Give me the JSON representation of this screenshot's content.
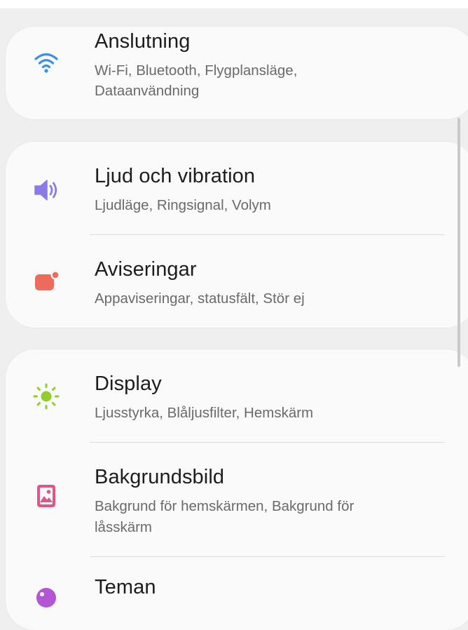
{
  "settings": {
    "connection": {
      "title": "Anslutning",
      "subtitle_line1": "Wi-Fi, Bluetooth, Flygplansläge,",
      "subtitle_line2": "Dataanvändning",
      "icon": "wifi-icon",
      "icon_color": "#3d8ee8"
    },
    "sound": {
      "title": "Ljud och vibration",
      "subtitle_line1": "Ljudläge, Ringsignal, Volym",
      "icon": "volume-icon",
      "icon_color": "#8b7be8"
    },
    "notifications": {
      "title": "Aviseringar",
      "subtitle_line1": "Appaviseringar, statusfält, Stör ej",
      "icon": "notification-icon",
      "icon_color": "#ee6a5a"
    },
    "display": {
      "title": "Display",
      "subtitle_line1": "Ljusstyrka, Blåljusfilter, Hemskärm",
      "icon": "brightness-icon",
      "icon_color": "#8fcf2a"
    },
    "wallpaper": {
      "title": "Bakgrundsbild",
      "subtitle_line1": "Bakgrund för hemskärmen, Bakgrund för",
      "subtitle_line2": "låsskärm",
      "icon": "wallpaper-icon",
      "icon_color": "#e0558a"
    },
    "themes": {
      "title": "Teman",
      "icon": "themes-icon",
      "icon_color": "#b454d6"
    }
  }
}
